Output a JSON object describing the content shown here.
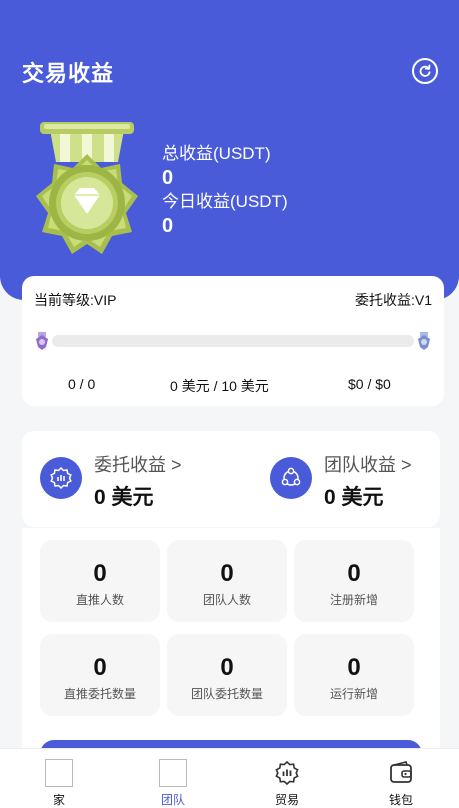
{
  "header": {
    "title": "交易收益",
    "refresh_icon": "refresh-icon",
    "bg_color": "#4a5bd9"
  },
  "stats": {
    "total_label": "总收益(USDT)",
    "total_value": "0",
    "today_label": "今日收益(USDT)",
    "today_value": "0"
  },
  "level": {
    "current": "当前等级:VIP",
    "commission": "委托收益:V1",
    "progress": 0,
    "count_text": "0 / 0",
    "amount_text": "0 美元 / 10 美元",
    "dollar_text": "$0 / $0"
  },
  "earnings": {
    "entrust_title": "委托收益 >",
    "entrust_amount": "0 美元",
    "team_title": "团队收益 >",
    "team_amount": "0 美元"
  },
  "grid": [
    {
      "value": "0",
      "label": "直推人数"
    },
    {
      "value": "0",
      "label": "团队人数"
    },
    {
      "value": "0",
      "label": "注册新增"
    },
    {
      "value": "0",
      "label": "直推委托数量"
    },
    {
      "value": "0",
      "label": "团队委托数量"
    },
    {
      "value": "0",
      "label": "运行新增"
    }
  ],
  "tabs": [
    {
      "label": "家",
      "icon": "home-icon"
    },
    {
      "label": "团队",
      "icon": "team-icon"
    },
    {
      "label": "贸易",
      "icon": "trade-icon"
    },
    {
      "label": "钱包",
      "icon": "wallet-icon"
    }
  ],
  "active_tab": "团队"
}
